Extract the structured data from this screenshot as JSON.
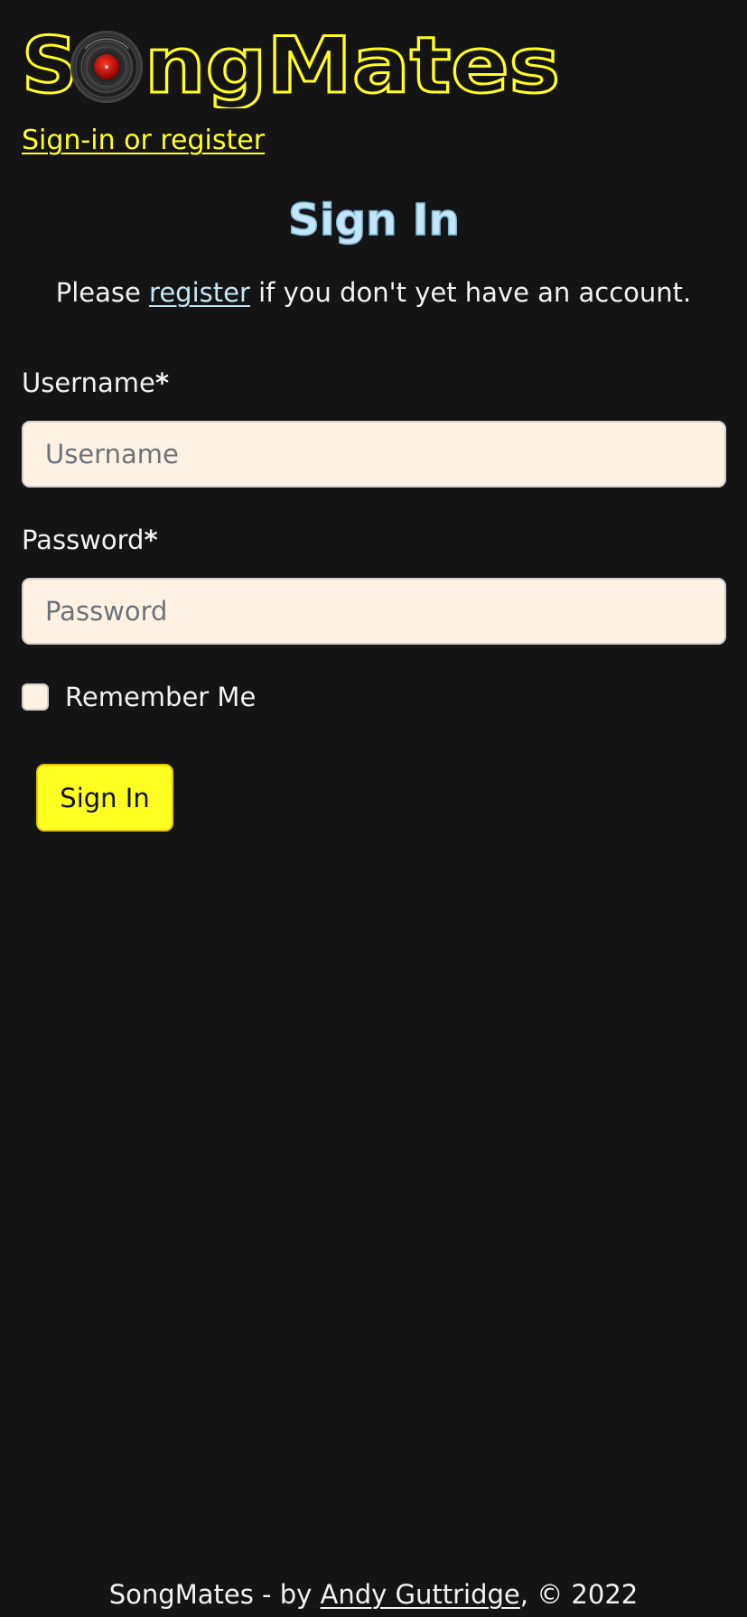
{
  "brand": {
    "name": "SongMates",
    "logo_text_before": "S",
    "logo_text_after": "ngMates",
    "logo_color": "#ffff22",
    "logo_icon": "vinyl-record-icon"
  },
  "nav": {
    "signin_link": "Sign-in or register"
  },
  "page": {
    "heading": "Sign In",
    "intro_before": "Please ",
    "intro_link": "register",
    "intro_after": " if you don't yet have an account."
  },
  "form": {
    "username_label": "Username",
    "username_placeholder": "Username",
    "username_value": "",
    "password_label": "Password",
    "password_placeholder": "Password",
    "password_value": "",
    "required_marker": "*",
    "remember_label": "Remember Me",
    "remember_checked": false,
    "submit_label": "Sign In"
  },
  "footer": {
    "text_before": "SongMates - by ",
    "author_link": "Andy Guttridge",
    "text_after": ", © 2022"
  },
  "colors": {
    "background": "#141414",
    "accent_yellow": "#ffff22",
    "input_background": "#fef2e4",
    "heading_blue": "#c6e6f5"
  }
}
